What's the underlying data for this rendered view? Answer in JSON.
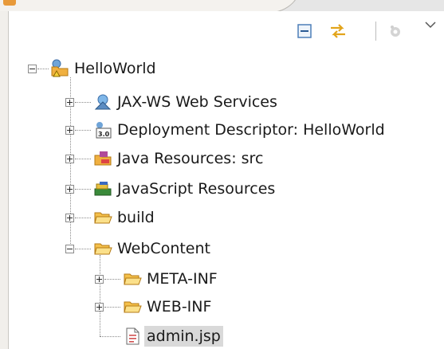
{
  "window": {
    "view_tab_label": ""
  },
  "toolbar": {
    "collapse_all_icon": "collapse-all-icon",
    "link_with_editor_icon": "link-with-editor-icon",
    "menu_icon": "view-menu-icon"
  },
  "tree": {
    "project": {
      "label": "HelloWorld",
      "expanded": true
    },
    "children": [
      {
        "label": "JAX-WS Web Services",
        "expanded": false
      },
      {
        "label": "Deployment Descriptor: HelloWorld",
        "expanded": false
      },
      {
        "label": "Java Resources: src",
        "expanded": false
      },
      {
        "label": "JavaScript Resources",
        "expanded": false
      },
      {
        "label": "build",
        "expanded": false
      },
      {
        "label": "WebContent",
        "expanded": true,
        "children": [
          {
            "label": "META-INF",
            "expanded": false
          },
          {
            "label": "WEB-INF",
            "expanded": false
          },
          {
            "label": "admin.jsp",
            "selected": true
          }
        ]
      }
    ]
  },
  "colors": {
    "selection": "#d9d9d9",
    "folder": "#f0b040",
    "tab_background": "#f4f2ee"
  }
}
